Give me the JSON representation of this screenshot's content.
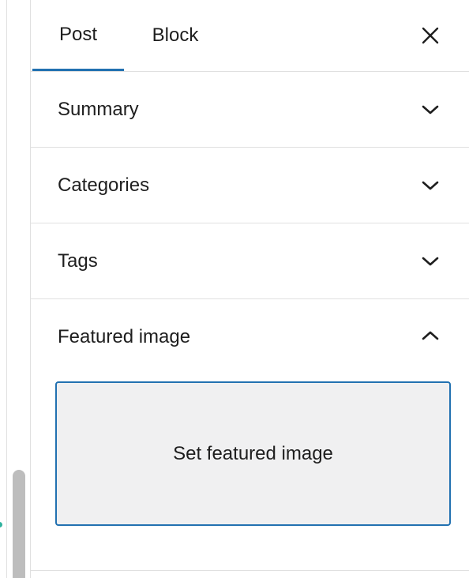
{
  "sidebar": {
    "tabs": [
      {
        "label": "Post",
        "active": true
      },
      {
        "label": "Block",
        "active": false
      }
    ],
    "close_icon": "close-icon",
    "panels": [
      {
        "title": "Summary",
        "expanded": false,
        "icon": "chevron-down-icon"
      },
      {
        "title": "Categories",
        "expanded": false,
        "icon": "chevron-down-icon"
      },
      {
        "title": "Tags",
        "expanded": false,
        "icon": "chevron-down-icon"
      },
      {
        "title": "Featured image",
        "expanded": true,
        "icon": "chevron-up-icon"
      }
    ],
    "featured_image": {
      "button_label": "Set featured image"
    }
  },
  "colors": {
    "accent": "#2271b1",
    "border": "#e0e0e0",
    "button_bg": "#f0f0f1",
    "text": "#1e1e1e",
    "scroll_thumb": "#bdbdbd",
    "indicator": "#2fb29e"
  }
}
